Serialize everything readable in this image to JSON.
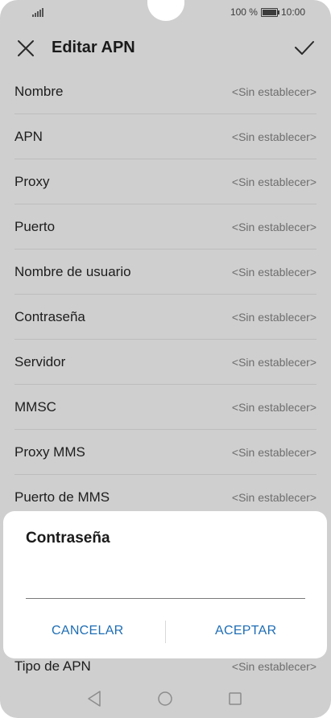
{
  "status_bar": {
    "battery_text": "100 %",
    "time": "10:00"
  },
  "header": {
    "title": "Editar APN"
  },
  "list": {
    "rows": [
      {
        "label": "Nombre",
        "value": "<Sin establecer>"
      },
      {
        "label": "APN",
        "value": "<Sin establecer>"
      },
      {
        "label": "Proxy",
        "value": "<Sin establecer>"
      },
      {
        "label": "Puerto",
        "value": "<Sin establecer>"
      },
      {
        "label": "Nombre de usuario",
        "value": "<Sin establecer>"
      },
      {
        "label": "Contraseña",
        "value": "<Sin establecer>"
      },
      {
        "label": "Servidor",
        "value": "<Sin establecer>"
      },
      {
        "label": "MMSC",
        "value": "<Sin establecer>"
      },
      {
        "label": "Proxy MMS",
        "value": "<Sin establecer>"
      },
      {
        "label": "Puerto de MMS",
        "value": "<Sin establecer>"
      }
    ],
    "tail": {
      "label": "Tipo de APN",
      "value": "<Sin establecer>"
    }
  },
  "dialog": {
    "title": "Contraseña",
    "input_value": "",
    "cancel_label": "CANCELAR",
    "accept_label": "ACEPTAR"
  },
  "colors": {
    "accent": "#1d6db5",
    "scrim_background": "#cfcfcf"
  }
}
